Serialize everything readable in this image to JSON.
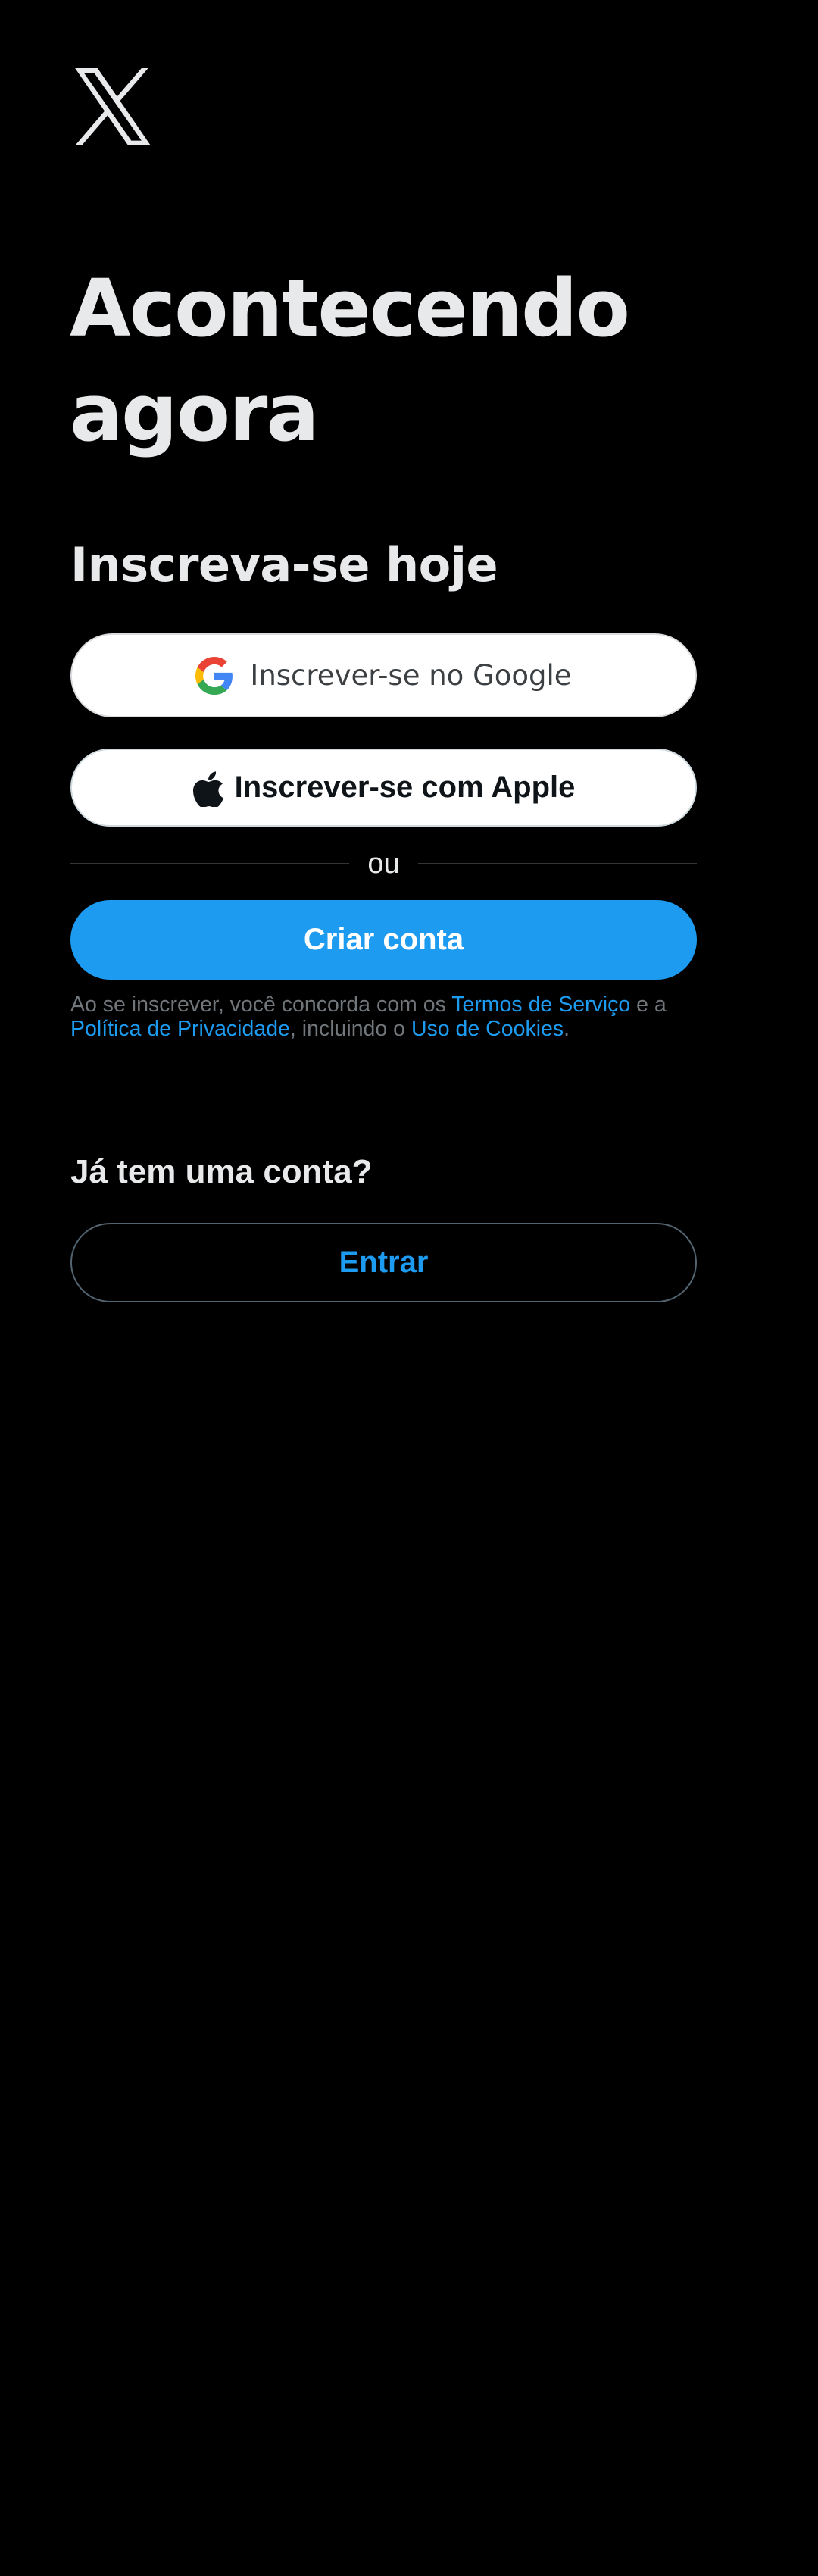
{
  "brand": {
    "logo_icon": "x-logo-icon",
    "logo_color": "#e7e9ea"
  },
  "hero": {
    "headline": "Acontecendo agora",
    "subheadline": "Inscreva-se hoje"
  },
  "signup": {
    "google_label": "Inscrever-se no Google",
    "google_icon": "google-icon",
    "apple_label": "Inscrever-se com Apple",
    "apple_icon": "apple-icon",
    "divider_label": "ou",
    "create_account_label": "Criar conta"
  },
  "terms": {
    "prefix": "Ao se inscrever, você concorda com os ",
    "terms_link": "Termos de Serviço",
    "middle": " e a ",
    "privacy_link": "Política de Privacidade",
    "middle2": ", incluindo o ",
    "cookies_link": "Uso de Cookies",
    "suffix": "."
  },
  "login": {
    "heading": "Já tem uma conta?",
    "login_label": "Entrar"
  },
  "colors": {
    "background": "#000000",
    "accent": "#1d9bf0",
    "text_primary": "#e7e9ea",
    "text_secondary": "#71767b",
    "border": "#536471"
  }
}
